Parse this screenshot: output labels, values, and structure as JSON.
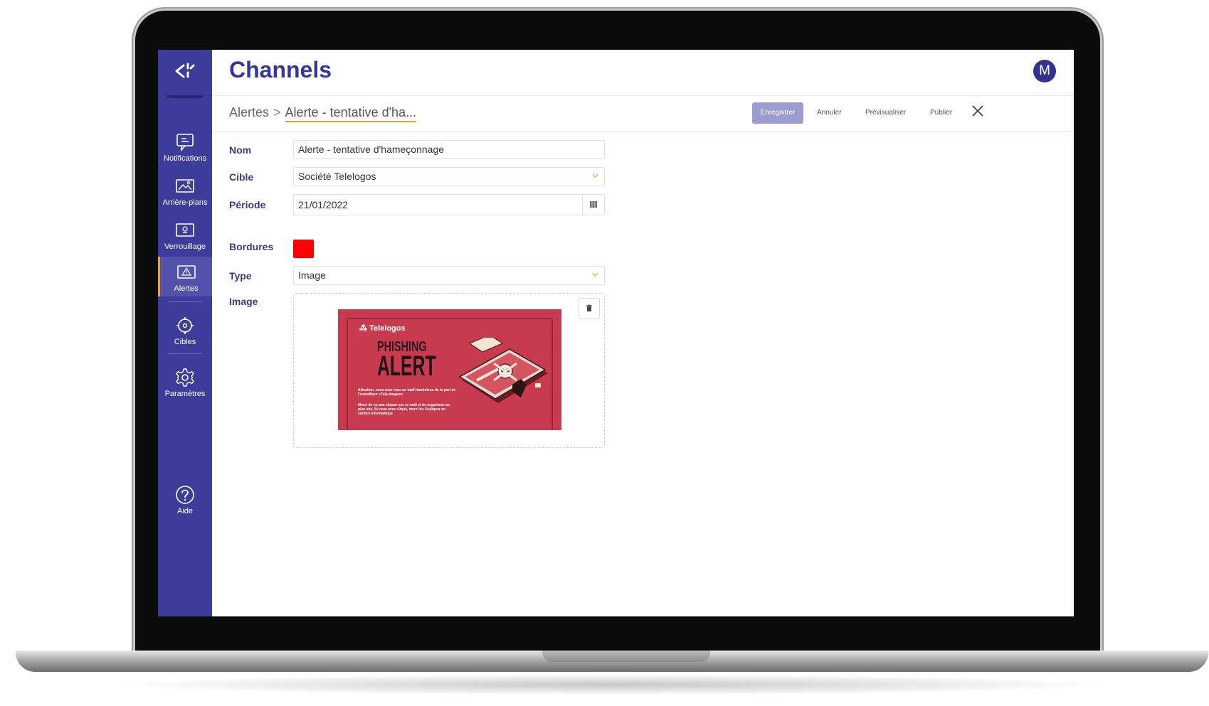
{
  "app": {
    "title": "Channels",
    "avatar_initial": "M"
  },
  "sidebar": {
    "items": [
      {
        "label": "Notifications",
        "icon": "chat-bubble-icon"
      },
      {
        "label": "Arrière-plans",
        "icon": "image-icon"
      },
      {
        "label": "Verrouillage",
        "icon": "lock-screen-icon"
      },
      {
        "label": "Alertes",
        "icon": "warning-triangle-icon",
        "active": true
      },
      {
        "label": "Cibles",
        "icon": "crosshair-icon"
      },
      {
        "label": "Paramètres",
        "icon": "gear-icon"
      },
      {
        "label": "Aide",
        "icon": "help-icon"
      }
    ]
  },
  "breadcrumb": {
    "parent": "Alertes",
    "separator": ">",
    "current": "Alerte - tentative d'ha..."
  },
  "toolbar": {
    "save_label": "Enregistrer",
    "cancel_label": "Annuler",
    "preview_label": "Prévisualiser",
    "publish_label": "Publier"
  },
  "form": {
    "nom": {
      "label": "Nom",
      "value": "Alerte - tentative d'hameçonnage"
    },
    "cible": {
      "label": "Cible",
      "value": "Société Telelogos"
    },
    "periode": {
      "label": "Période",
      "value": "21/01/2022"
    },
    "bordures": {
      "label": "Bordures",
      "color": "#ff0000"
    },
    "type": {
      "label": "Type",
      "value": "Image"
    },
    "image": {
      "label": "Image"
    }
  },
  "alert_image": {
    "brand": "Telelogos",
    "line1": "PHISHING",
    "line2": "ALERT",
    "text1": "Attention, vous avez reçu un mail frauduleux de la part de l'expéditeur «Tele-images»",
    "text2": "Merci de ne pas cliquer sur ce mail et de supprimer au plus vite. Si vous avez cliqué, merci de l'indiquer au service informatique"
  },
  "colors": {
    "sidebar": "#3c3c9a",
    "accent": "#f0a030",
    "title": "#35359a"
  }
}
